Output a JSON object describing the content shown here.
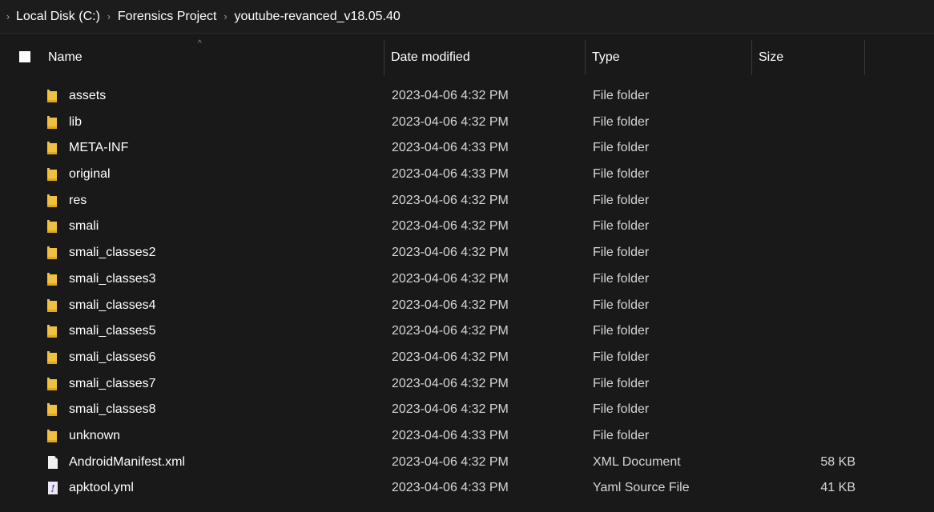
{
  "breadcrumb": {
    "items": [
      "Local Disk (C:)",
      "Forensics Project",
      "youtube-revanced_v18.05.40"
    ],
    "separator": ">"
  },
  "columns": {
    "name": "Name",
    "date_modified": "Date modified",
    "type": "Type",
    "size": "Size"
  },
  "sort_indicator": "^",
  "files": [
    {
      "name": "assets",
      "date": "2023-04-06 4:32 PM",
      "type": "File folder",
      "size": "",
      "icon": "folder-icon"
    },
    {
      "name": "lib",
      "date": "2023-04-06 4:32 PM",
      "type": "File folder",
      "size": "",
      "icon": "folder-icon"
    },
    {
      "name": "META-INF",
      "date": "2023-04-06 4:33 PM",
      "type": "File folder",
      "size": "",
      "icon": "folder-icon"
    },
    {
      "name": "original",
      "date": "2023-04-06 4:33 PM",
      "type": "File folder",
      "size": "",
      "icon": "folder-icon"
    },
    {
      "name": "res",
      "date": "2023-04-06 4:32 PM",
      "type": "File folder",
      "size": "",
      "icon": "folder-icon"
    },
    {
      "name": "smali",
      "date": "2023-04-06 4:32 PM",
      "type": "File folder",
      "size": "",
      "icon": "folder-icon"
    },
    {
      "name": "smali_classes2",
      "date": "2023-04-06 4:32 PM",
      "type": "File folder",
      "size": "",
      "icon": "folder-icon"
    },
    {
      "name": "smali_classes3",
      "date": "2023-04-06 4:32 PM",
      "type": "File folder",
      "size": "",
      "icon": "folder-icon"
    },
    {
      "name": "smali_classes4",
      "date": "2023-04-06 4:32 PM",
      "type": "File folder",
      "size": "",
      "icon": "folder-icon"
    },
    {
      "name": "smali_classes5",
      "date": "2023-04-06 4:32 PM",
      "type": "File folder",
      "size": "",
      "icon": "folder-icon"
    },
    {
      "name": "smali_classes6",
      "date": "2023-04-06 4:32 PM",
      "type": "File folder",
      "size": "",
      "icon": "folder-icon"
    },
    {
      "name": "smali_classes7",
      "date": "2023-04-06 4:32 PM",
      "type": "File folder",
      "size": "",
      "icon": "folder-icon"
    },
    {
      "name": "smali_classes8",
      "date": "2023-04-06 4:32 PM",
      "type": "File folder",
      "size": "",
      "icon": "folder-icon"
    },
    {
      "name": "unknown",
      "date": "2023-04-06 4:33 PM",
      "type": "File folder",
      "size": "",
      "icon": "folder-icon"
    },
    {
      "name": "AndroidManifest.xml",
      "date": "2023-04-06 4:32 PM",
      "type": "XML Document",
      "size": "58 KB",
      "icon": "xml-file-icon"
    },
    {
      "name": "apktool.yml",
      "date": "2023-04-06 4:33 PM",
      "type": "Yaml Source File",
      "size": "41 KB",
      "icon": "yaml-file-icon"
    }
  ],
  "colors": {
    "background": "#191919",
    "folder": "#f0c040",
    "file": "#f2f2f2",
    "yaml_icon_bg": "#ece9f5",
    "yaml_icon_mark": "#5b3f9a"
  }
}
